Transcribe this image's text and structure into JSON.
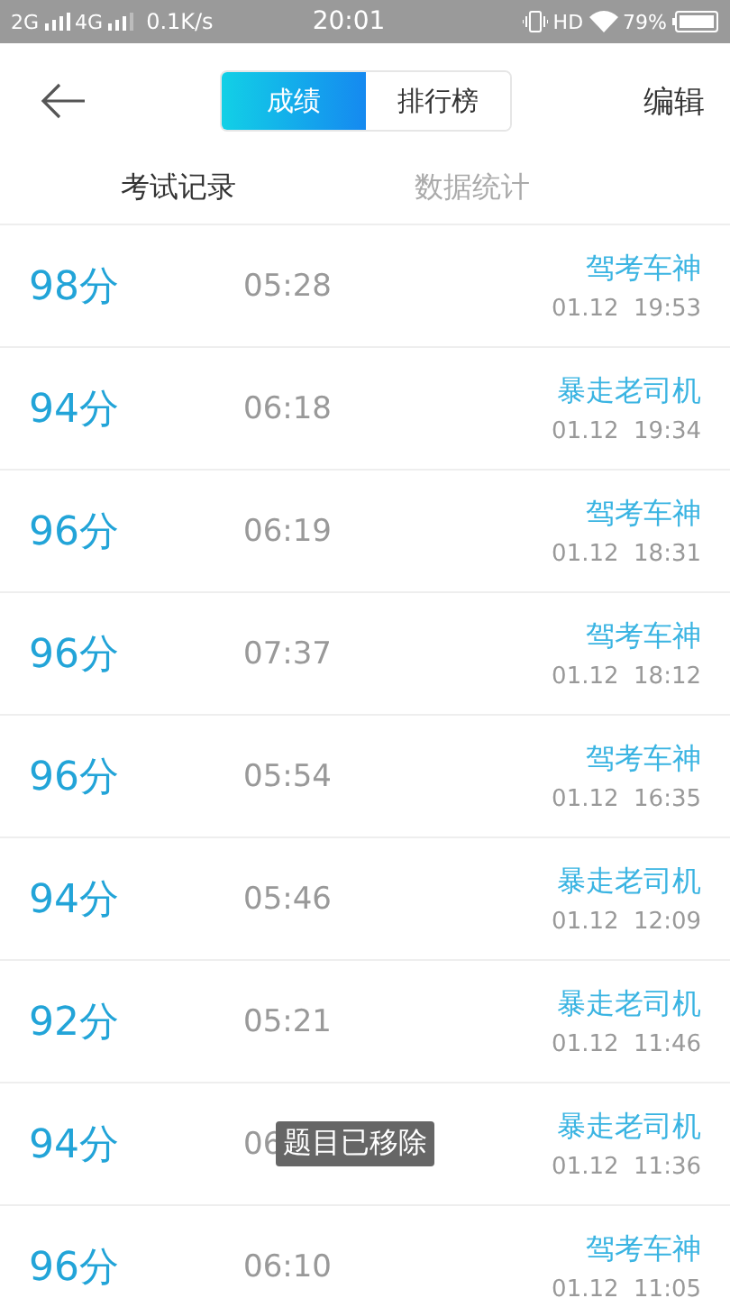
{
  "status_bar": {
    "network_1": "2G",
    "network_2": "4G",
    "speed": "0.1K/s",
    "time": "20:01",
    "hd": "HD",
    "battery": "79%"
  },
  "header": {
    "segments": [
      {
        "label": "成绩",
        "selected": true
      },
      {
        "label": "排行榜",
        "selected": false
      }
    ],
    "action": "编辑"
  },
  "tabs": [
    {
      "label": "考试记录",
      "selected": true
    },
    {
      "label": "数据统计",
      "selected": false
    }
  ],
  "records": [
    {
      "score": "98分",
      "duration": "05:28",
      "title": "驾考车神",
      "date": "01.12  19:53"
    },
    {
      "score": "94分",
      "duration": "06:18",
      "title": "暴走老司机",
      "date": "01.12  19:34"
    },
    {
      "score": "96分",
      "duration": "06:19",
      "title": "驾考车神",
      "date": "01.12  18:31"
    },
    {
      "score": "96分",
      "duration": "07:37",
      "title": "驾考车神",
      "date": "01.12  18:12"
    },
    {
      "score": "96分",
      "duration": "05:54",
      "title": "驾考车神",
      "date": "01.12  16:35"
    },
    {
      "score": "94分",
      "duration": "05:46",
      "title": "暴走老司机",
      "date": "01.12  12:09"
    },
    {
      "score": "92分",
      "duration": "05:21",
      "title": "暴走老司机",
      "date": "01.12  11:46"
    },
    {
      "score": "94分",
      "duration": "06",
      "title": "暴走老司机",
      "date": "01.12  11:36"
    },
    {
      "score": "96分",
      "duration": "06:10",
      "title": "驾考车神",
      "date": "01.12  11:05"
    }
  ],
  "toast": "题目已移除"
}
